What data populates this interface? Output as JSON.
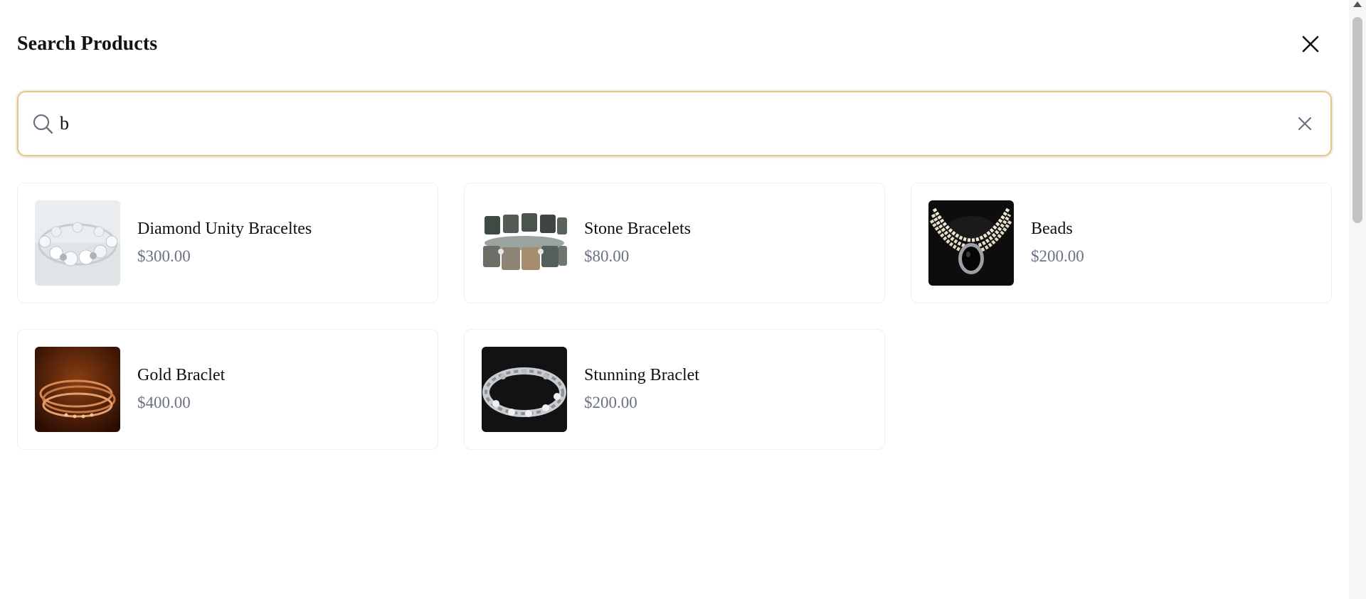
{
  "header": {
    "title": "Search Products",
    "close_icon": "close-icon"
  },
  "search": {
    "value": "b",
    "icon": "search-icon",
    "clear_icon": "clear-icon",
    "focus_color": "#e3c68b"
  },
  "products": [
    {
      "name": "Diamond Unity Braceltes",
      "price": "$300.00"
    },
    {
      "name": "Stone Bracelets",
      "price": "$80.00"
    },
    {
      "name": "Beads",
      "price": "$200.00"
    },
    {
      "name": "Gold Braclet",
      "price": "$400.00"
    },
    {
      "name": "Stunning Braclet",
      "price": "$200.00"
    }
  ],
  "colors": {
    "price_text": "#6b7280",
    "card_border": "#f0f0f0"
  }
}
